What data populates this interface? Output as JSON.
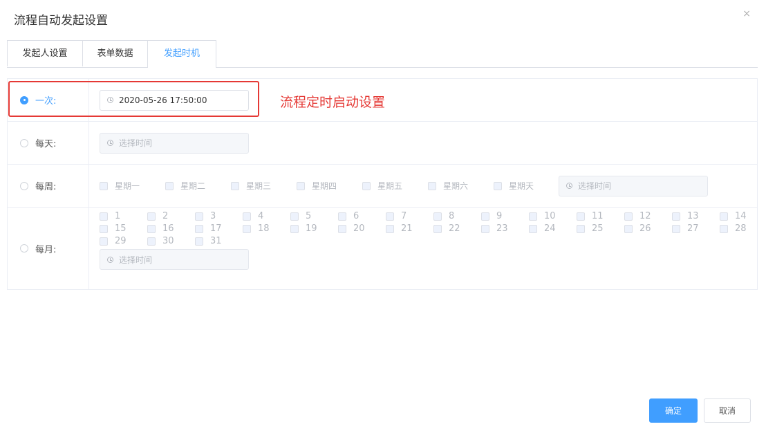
{
  "dialog": {
    "title": "流程自动发起设置",
    "close": "×"
  },
  "tabs": [
    {
      "label": "发起人设置",
      "active": false
    },
    {
      "label": "表单数据",
      "active": false
    },
    {
      "label": "发起时机",
      "active": true
    }
  ],
  "rows": {
    "once": {
      "label": "一次:",
      "checked": true,
      "value": "2020-05-26 17:50:00"
    },
    "daily": {
      "label": "每天:",
      "checked": false,
      "placeholder": "选择时间"
    },
    "weekly": {
      "label": "每周:",
      "checked": false,
      "placeholder": "选择时间",
      "days": [
        "星期一",
        "星期二",
        "星期三",
        "星期四",
        "星期五",
        "星期六",
        "星期天"
      ]
    },
    "monthly": {
      "label": "每月:",
      "checked": false,
      "placeholder": "选择时间",
      "days": [
        "1",
        "2",
        "3",
        "4",
        "5",
        "6",
        "7",
        "8",
        "9",
        "10",
        "11",
        "12",
        "13",
        "14",
        "15",
        "16",
        "17",
        "18",
        "19",
        "20",
        "21",
        "22",
        "23",
        "24",
        "25",
        "26",
        "27",
        "28",
        "29",
        "30",
        "31"
      ]
    }
  },
  "annotation": {
    "text": "流程定时启动设置",
    "color": "#e53935"
  },
  "buttons": {
    "ok": "确定",
    "cancel": "取消"
  },
  "colors": {
    "accent": "#409eff"
  }
}
